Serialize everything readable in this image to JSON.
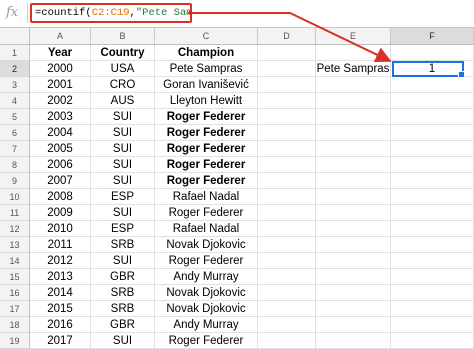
{
  "formula_bar": {
    "fx_label": "fx",
    "formula_prefix": "=countif(",
    "formula_range": "C2:C19",
    "formula_sep": ",",
    "formula_string": "\"Pete Sampras\"",
    "formula_suffix": ")"
  },
  "columns": [
    "A",
    "B",
    "C",
    "D",
    "E",
    "F"
  ],
  "selected_column": "F",
  "selected_row": "2",
  "header_row": {
    "year": "Year",
    "country": "Country",
    "champion": "Champion"
  },
  "rows": [
    {
      "num": "1"
    },
    {
      "num": "2",
      "year": "2000",
      "country": "USA",
      "champion": "Pete Sampras",
      "bold": false,
      "e": "Pete Sampras",
      "f": "1"
    },
    {
      "num": "3",
      "year": "2001",
      "country": "CRO",
      "champion": "Goran Ivanišević",
      "bold": false
    },
    {
      "num": "4",
      "year": "2002",
      "country": "AUS",
      "champion": "Lleyton Hewitt",
      "bold": false
    },
    {
      "num": "5",
      "year": "2003",
      "country": "SUI",
      "champion": "Roger Federer",
      "bold": true
    },
    {
      "num": "6",
      "year": "2004",
      "country": "SUI",
      "champion": "Roger Federer",
      "bold": true
    },
    {
      "num": "7",
      "year": "2005",
      "country": "SUI",
      "champion": "Roger Federer",
      "bold": true
    },
    {
      "num": "8",
      "year": "2006",
      "country": "SUI",
      "champion": "Roger Federer",
      "bold": true
    },
    {
      "num": "9",
      "year": "2007",
      "country": "SUI",
      "champion": "Roger Federer",
      "bold": true
    },
    {
      "num": "10",
      "year": "2008",
      "country": "ESP",
      "champion": "Rafael Nadal",
      "bold": false
    },
    {
      "num": "11",
      "year": "2009",
      "country": "SUI",
      "champion": "Roger Federer",
      "bold": false
    },
    {
      "num": "12",
      "year": "2010",
      "country": "ESP",
      "champion": "Rafael Nadal",
      "bold": false
    },
    {
      "num": "13",
      "year": "2011",
      "country": "SRB",
      "champion": "Novak Djokovic",
      "bold": false
    },
    {
      "num": "14",
      "year": "2012",
      "country": "SUI",
      "champion": "Roger Federer",
      "bold": false
    },
    {
      "num": "15",
      "year": "2013",
      "country": "GBR",
      "champion": "Andy Murray",
      "bold": false
    },
    {
      "num": "16",
      "year": "2014",
      "country": "SRB",
      "champion": "Novak Djokovic",
      "bold": false
    },
    {
      "num": "17",
      "year": "2015",
      "country": "SRB",
      "champion": "Novak Djokovic",
      "bold": false
    },
    {
      "num": "18",
      "year": "2016",
      "country": "GBR",
      "champion": "Andy Murray",
      "bold": false
    },
    {
      "num": "19",
      "year": "2017",
      "country": "SUI",
      "champion": "Roger Federer",
      "bold": false
    }
  ],
  "colors": {
    "arrow": "#d93025",
    "selection": "#1a73e8",
    "range_text": "#e06c00",
    "string_text": "#188038"
  }
}
